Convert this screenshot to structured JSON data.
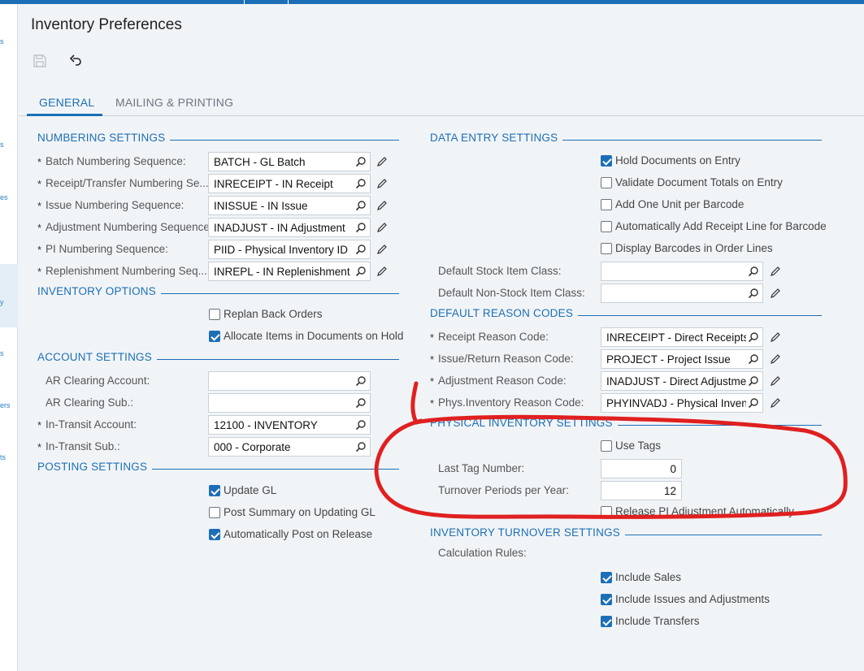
{
  "page": {
    "title": "Inventory Preferences"
  },
  "toolbar": {
    "save_icon": "save-icon",
    "undo_icon": "undo-icon"
  },
  "tabs": [
    {
      "label": "GENERAL",
      "active": true
    },
    {
      "label": "MAILING & PRINTING",
      "active": false
    }
  ],
  "leftnav_fragments": [
    "s",
    "s",
    "es",
    "y",
    "s",
    "ers",
    "ts"
  ],
  "numbering": {
    "title": "NUMBERING SETTINGS",
    "fields": [
      {
        "label": "Batch Numbering Sequence:",
        "value": "BATCH - GL Batch"
      },
      {
        "label": "Receipt/Transfer Numbering Se...",
        "value": "INRECEIPT - IN Receipt"
      },
      {
        "label": "Issue Numbering Sequence:",
        "value": "INISSUE - IN Issue"
      },
      {
        "label": "Adjustment Numbering Sequence:",
        "value": "INADJUST - IN Adjustment"
      },
      {
        "label": "PI Numbering Sequence:",
        "value": "PIID - Physical Inventory ID"
      },
      {
        "label": "Replenishment Numbering Seq...",
        "value": "INREPL - IN Replenishment"
      }
    ]
  },
  "inventory_options": {
    "title": "INVENTORY OPTIONS",
    "checks": [
      {
        "label": "Replan Back Orders",
        "checked": false
      },
      {
        "label": "Allocate Items in Documents on Hold",
        "checked": true
      }
    ]
  },
  "account": {
    "title": "ACCOUNT SETTINGS",
    "fields": [
      {
        "label": "AR Clearing Account:",
        "value": ""
      },
      {
        "label": "AR Clearing Sub.:",
        "value": ""
      },
      {
        "label": "In-Transit Account:",
        "value": "12100 - INVENTORY"
      },
      {
        "label": "In-Transit Sub.:",
        "value": "000 - Corporate"
      }
    ]
  },
  "posting": {
    "title": "POSTING SETTINGS",
    "checks": [
      {
        "label": "Update GL",
        "checked": true
      },
      {
        "label": "Post Summary on Updating GL",
        "checked": false
      },
      {
        "label": "Automatically Post on Release",
        "checked": true
      }
    ]
  },
  "data_entry": {
    "title": "DATA ENTRY SETTINGS",
    "checks": [
      {
        "label": "Hold Documents on Entry",
        "checked": true
      },
      {
        "label": "Validate Document Totals on Entry",
        "checked": false
      },
      {
        "label": "Add One Unit per Barcode",
        "checked": false
      },
      {
        "label": "Automatically Add Receipt Line for Barcode",
        "checked": false
      },
      {
        "label": "Display Barcodes in Order Lines",
        "checked": false
      }
    ],
    "fields": [
      {
        "label": "Default Stock Item Class:",
        "value": ""
      },
      {
        "label": "Default Non-Stock Item Class:",
        "value": ""
      }
    ]
  },
  "reason_codes": {
    "title": "DEFAULT REASON CODES",
    "fields": [
      {
        "label": "Receipt Reason Code:",
        "value": "INRECEIPT - Direct Receipts"
      },
      {
        "label": "Issue/Return Reason Code:",
        "value": "PROJECT - Project Issue"
      },
      {
        "label": "Adjustment Reason Code:",
        "value": "INADJUST - Direct Adjustments"
      },
      {
        "label": "Phys.Inventory Reason Code:",
        "value": "PHYINVADJ - Physical Inventory"
      }
    ]
  },
  "physical_inventory": {
    "title": "PHYSICAL INVENTORY SETTINGS",
    "use_tags": {
      "label": "Use Tags",
      "checked": false
    },
    "last_tag": {
      "label": "Last Tag Number:",
      "value": "0"
    },
    "turnover": {
      "label": "Turnover Periods per Year:",
      "value": "12"
    },
    "release": {
      "label": "Release PI Adjustment Automatically",
      "checked": false
    }
  },
  "turnover": {
    "title": "INVENTORY TURNOVER SETTINGS",
    "calc_label": "Calculation Rules:",
    "checks": [
      {
        "label": "Include Sales",
        "checked": true
      },
      {
        "label": "Include Issues and Adjustments",
        "checked": true
      },
      {
        "label": "Include Transfers",
        "checked": true
      }
    ]
  },
  "colors": {
    "accent": "#1c6fb6",
    "annotation": "#e02020",
    "background": "#f1f4f7"
  }
}
